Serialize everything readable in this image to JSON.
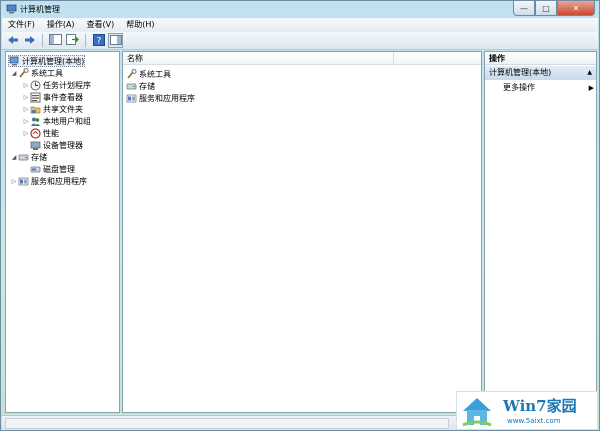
{
  "window": {
    "title": "计算机管理"
  },
  "caption": {
    "minimize": "—",
    "maximize": "□",
    "close": "✕"
  },
  "menubar": [
    {
      "label": "文件(F)"
    },
    {
      "label": "操作(A)"
    },
    {
      "label": "查看(V)"
    },
    {
      "label": "帮助(H)"
    }
  ],
  "toolbar": {
    "buttons": [
      {
        "name": "back",
        "icon": "back-arrow-icon"
      },
      {
        "name": "forward",
        "icon": "forward-arrow-icon"
      },
      {
        "name": "show-hide-console-tree",
        "icon": "console-tree-icon"
      },
      {
        "name": "export-list",
        "icon": "export-icon"
      },
      {
        "name": "help",
        "icon": "help-icon"
      },
      {
        "name": "show-hide-action-pane",
        "icon": "action-pane-icon"
      }
    ]
  },
  "tree": {
    "root": "计算机管理(本地)",
    "system_tools": "系统工具",
    "task_scheduler": "任务计划程序",
    "event_viewer": "事件查看器",
    "shared_folders": "共享文件夹",
    "local_users": "本地用户和组",
    "performance": "性能",
    "device_manager": "设备管理器",
    "storage": "存储",
    "disk_management": "磁盘管理",
    "services_apps": "服务和应用程序"
  },
  "list": {
    "column_name": "名称",
    "items": [
      {
        "label": "系统工具"
      },
      {
        "label": "存储"
      },
      {
        "label": "服务和应用程序"
      }
    ]
  },
  "actions": {
    "header": "操作",
    "section": "计算机管理(本地)",
    "more": "更多操作"
  },
  "watermark": {
    "title": "Win7家园",
    "url": "www.5aixt.com"
  }
}
